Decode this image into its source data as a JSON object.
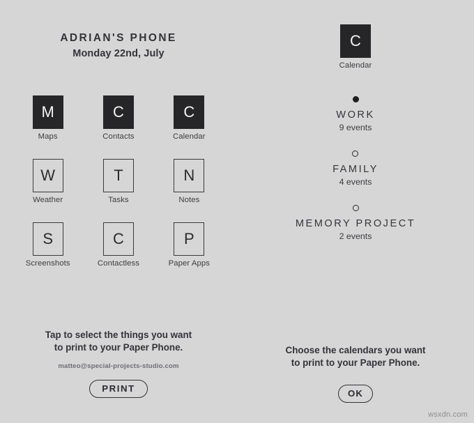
{
  "colors": {
    "background": "#d6d6d6",
    "ink": "#2b2b2b",
    "tile_selected_bg": "#262628",
    "tile_selected_fg": "#f4f4f4",
    "tile_border": "#3a3a3a",
    "watermark": "#8e8e93"
  },
  "left_panel": {
    "title": "ADRIAN'S PHONE",
    "date": "Monday 22nd, July",
    "apps": [
      {
        "letter": "M",
        "label": "Maps",
        "selected": true
      },
      {
        "letter": "C",
        "label": "Contacts",
        "selected": true
      },
      {
        "letter": "C",
        "label": "Calendar",
        "selected": true
      },
      {
        "letter": "W",
        "label": "Weather",
        "selected": false
      },
      {
        "letter": "T",
        "label": "Tasks",
        "selected": false
      },
      {
        "letter": "N",
        "label": "Notes",
        "selected": false
      },
      {
        "letter": "S",
        "label": "Screenshots",
        "selected": false
      },
      {
        "letter": "C",
        "label": "Contactless",
        "selected": false
      },
      {
        "letter": "P",
        "label": "Paper Apps",
        "selected": false
      }
    ],
    "hint_line1": "Tap to select the things you want",
    "hint_line2": "to print to your Paper Phone.",
    "email": "matteo@special-projects-studio.com",
    "print_button": "PRINT"
  },
  "right_panel": {
    "app": {
      "letter": "C",
      "label": "Calendar",
      "selected": true
    },
    "calendars": [
      {
        "name": "WORK",
        "events": "9 events",
        "selected": true
      },
      {
        "name": "FAMILY",
        "events": "4 events",
        "selected": false
      },
      {
        "name": "MEMORY PROJECT",
        "events": "2 events",
        "selected": false
      }
    ],
    "hint_line1": "Choose the calendars you want",
    "hint_line2": "to print to your Paper Phone.",
    "ok_button": "OK"
  },
  "watermark": "wsxdn.com"
}
